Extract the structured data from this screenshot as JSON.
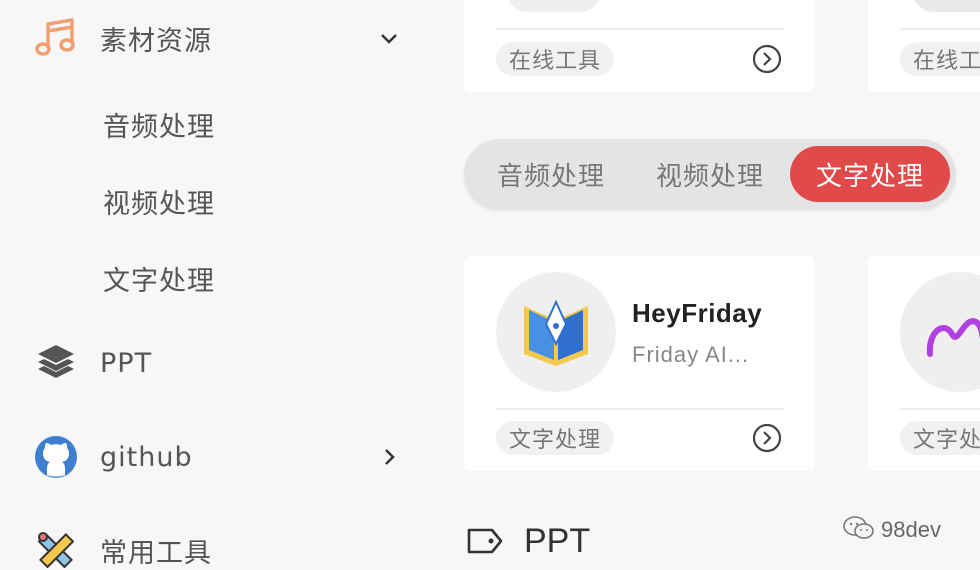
{
  "sidebar": {
    "group": {
      "label": "素材资源",
      "icon": "music-note-icon"
    },
    "sub_items": [
      {
        "label": "音频处理"
      },
      {
        "label": "视频处理"
      },
      {
        "label": "文字处理"
      }
    ],
    "items": [
      {
        "label": "PPT",
        "icon": "layers-icon"
      },
      {
        "label": "github",
        "icon": "github-icon"
      },
      {
        "label": "常用工具",
        "icon": "pencil-ruler-icon"
      }
    ]
  },
  "top_cards": [
    {
      "tag": "在线工具"
    },
    {
      "tag": "在线工"
    }
  ],
  "tabs": [
    {
      "label": "音频处理",
      "active": false
    },
    {
      "label": "视频处理",
      "active": false
    },
    {
      "label": "文字处理",
      "active": true
    }
  ],
  "cards": [
    {
      "title": "HeyFriday",
      "desc": "Friday AI...",
      "tag": "文字处理",
      "icon": "book-pen-logo-icon"
    },
    {
      "tag": "文字处",
      "icon": "purple-swirl-logo-icon"
    }
  ],
  "section": {
    "title": "PPT",
    "icon": "tag-icon"
  },
  "watermark": {
    "text": "98dev",
    "icon": "wechat-icon"
  },
  "colors": {
    "accent": "#e04a4a",
    "music_icon": "#f0a070",
    "github_icon": "#3f7fcf"
  }
}
